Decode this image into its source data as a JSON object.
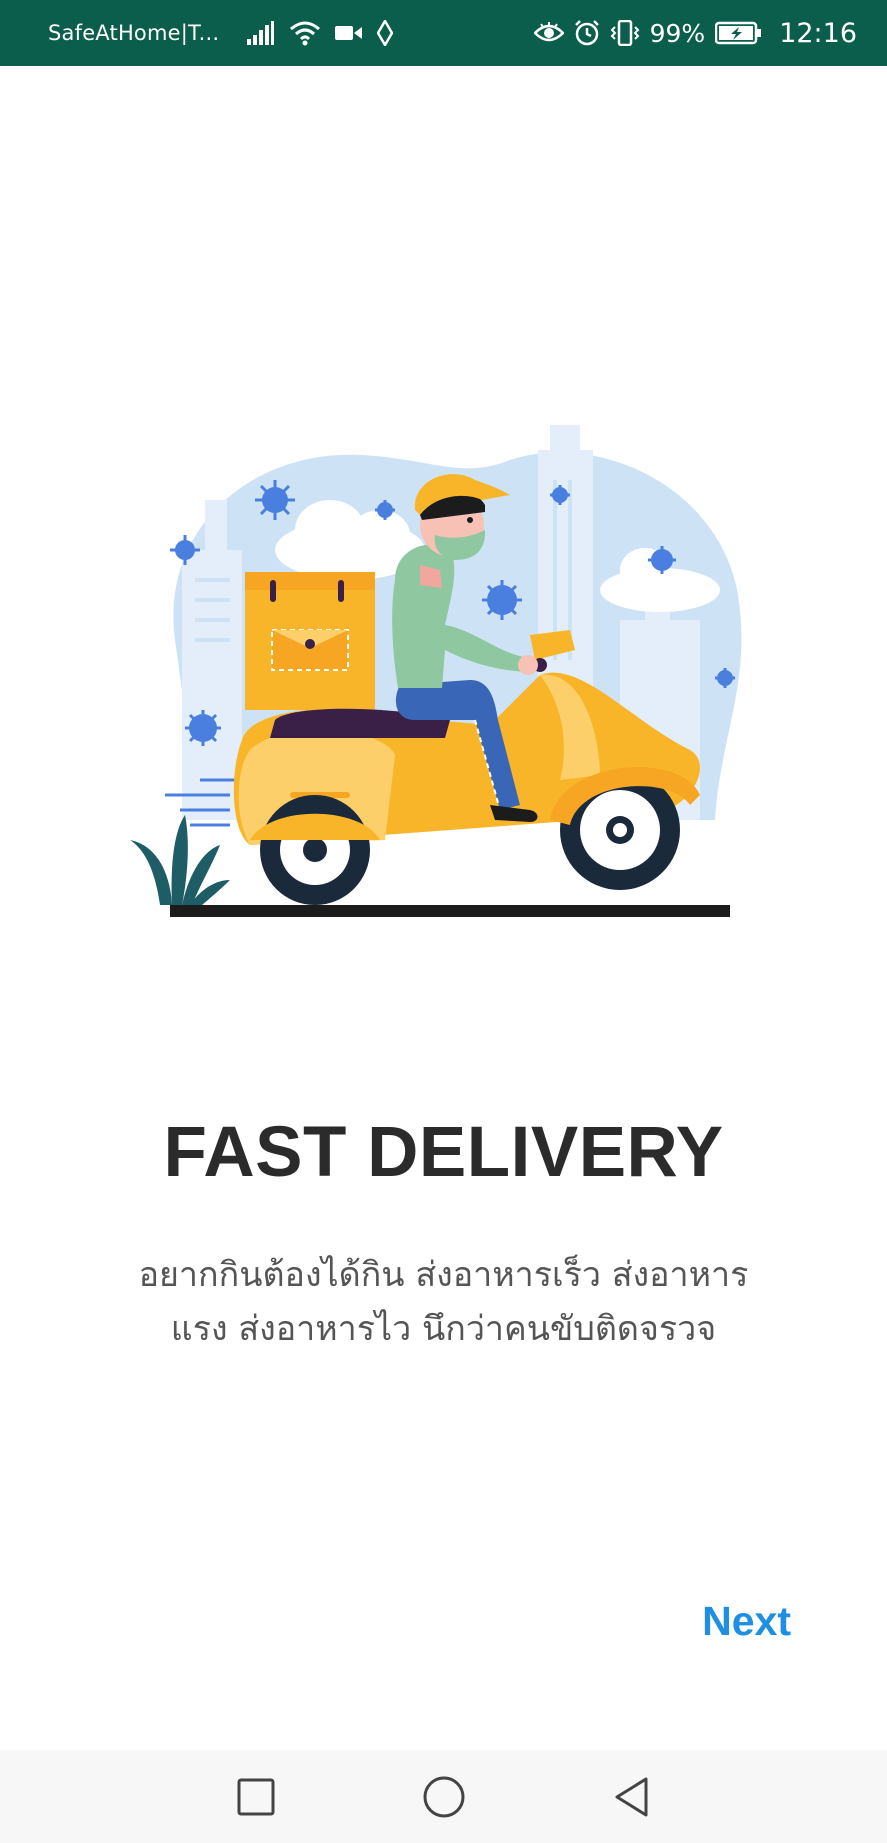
{
  "status_bar": {
    "app_name": "SafeAtHome|T...",
    "battery_percent": "99%",
    "time": "12:16",
    "background_color": "#0b5d4c",
    "icons_left": [
      "signal-icon",
      "wifi-icon",
      "video-camera-icon",
      "location-icon"
    ],
    "icons_right": [
      "eye-icon",
      "alarm-icon",
      "vibrate-icon",
      "battery-charging-icon"
    ]
  },
  "onboarding": {
    "illustration": "delivery-scooter-illustration",
    "title": "FAST DELIVERY",
    "description": "อยากกินต้องได้กิน ส่งอาหารเร็ว ส่งอาหารแรง ส่งอาหารไว นึกว่าคนขับติดจรวจ",
    "next_label": "Next",
    "accent_color": "#1e8fe3"
  },
  "nav_bar": {
    "buttons": [
      "recents-square-icon",
      "home-circle-icon",
      "back-triangle-icon"
    ]
  }
}
